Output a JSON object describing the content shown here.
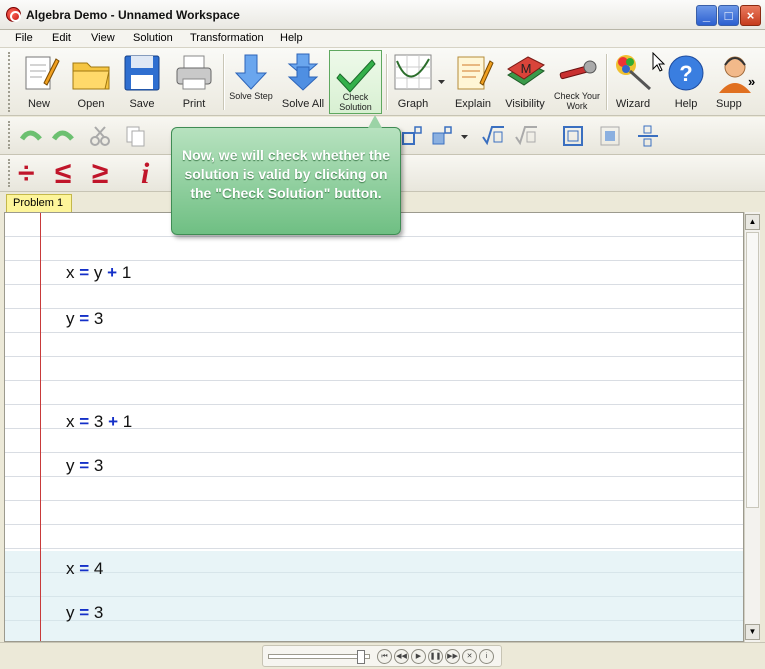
{
  "window": {
    "title": "Algebra Demo - Unnamed Workspace",
    "minimize": "_",
    "maximize": "□",
    "close": "×"
  },
  "menu": {
    "items": [
      "File",
      "Edit",
      "View",
      "Solution",
      "Transformation",
      "Help"
    ]
  },
  "toolbar": {
    "new": "New",
    "open": "Open",
    "save": "Save",
    "print": "Print",
    "solve_step": "Solve Step",
    "solve_all": "Solve All",
    "check_solution": "Check Solution",
    "graph": "Graph",
    "explain": "Explain",
    "visibility": "Visibility",
    "check_work": "Check Your Work",
    "wizard": "Wizard",
    "help": "Help",
    "support": "Supp",
    "overflow": "»"
  },
  "symbols": {
    "divide": "÷",
    "le": "≤",
    "ge": "≥",
    "info": "i",
    "visibility_letter": "M",
    "help_q": "?"
  },
  "tabs": {
    "problem1": "Problem 1"
  },
  "equations": {
    "e1": {
      "lhs": "x",
      "eq": "=",
      "a": "y",
      "op": "+",
      "b": "1"
    },
    "e2": {
      "lhs": "y",
      "eq": "=",
      "b": "3"
    },
    "e3": {
      "lhs": "x",
      "eq": "=",
      "a": "3",
      "op": "+",
      "b": "1"
    },
    "e4": {
      "lhs": "y",
      "eq": "=",
      "b": "3"
    },
    "e5": {
      "lhs": "x",
      "eq": "=",
      "b": "4"
    },
    "e6": {
      "lhs": "y",
      "eq": "=",
      "b": "3"
    }
  },
  "callout": {
    "text": "Now, we will check whether the solution is valid by clicking on the \"Check Solution\" button."
  },
  "player": {
    "first": "⏮",
    "prev": "◀◀",
    "play": "▶",
    "pause": "❚❚",
    "next": "▶▶",
    "stop": "✕",
    "info": "i"
  }
}
